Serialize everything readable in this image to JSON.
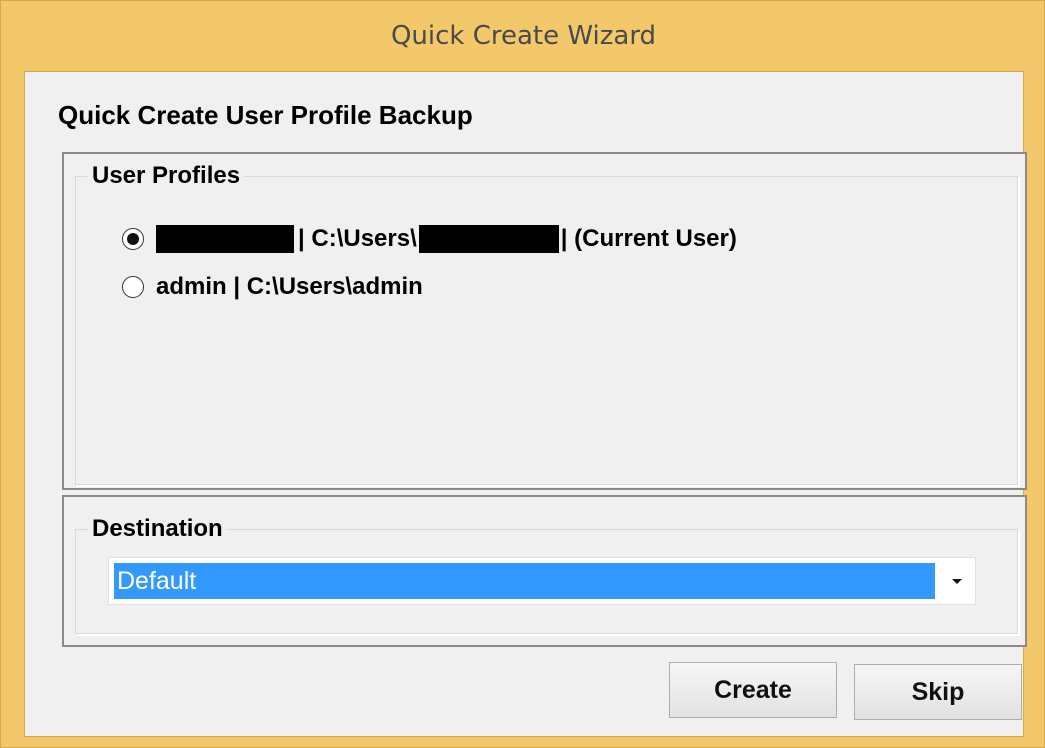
{
  "window": {
    "title": "Quick Create Wizard"
  },
  "dialog": {
    "heading": "Quick Create User Profile Backup"
  },
  "profiles": {
    "legend": "User Profiles",
    "items": [
      {
        "selected": true,
        "sep_1": "| C:\\Users\\",
        "suffix": "| (Current User)",
        "redacted": true
      },
      {
        "selected": false,
        "label": "admin | C:\\Users\\admin"
      }
    ]
  },
  "destination": {
    "legend": "Destination",
    "selected": "Default"
  },
  "buttons": {
    "create_label": "Create",
    "skip_label": "Skip"
  },
  "colors": {
    "titlebar": "#f3c86a",
    "selection": "#3399ff",
    "client": "#f0f0f0"
  }
}
